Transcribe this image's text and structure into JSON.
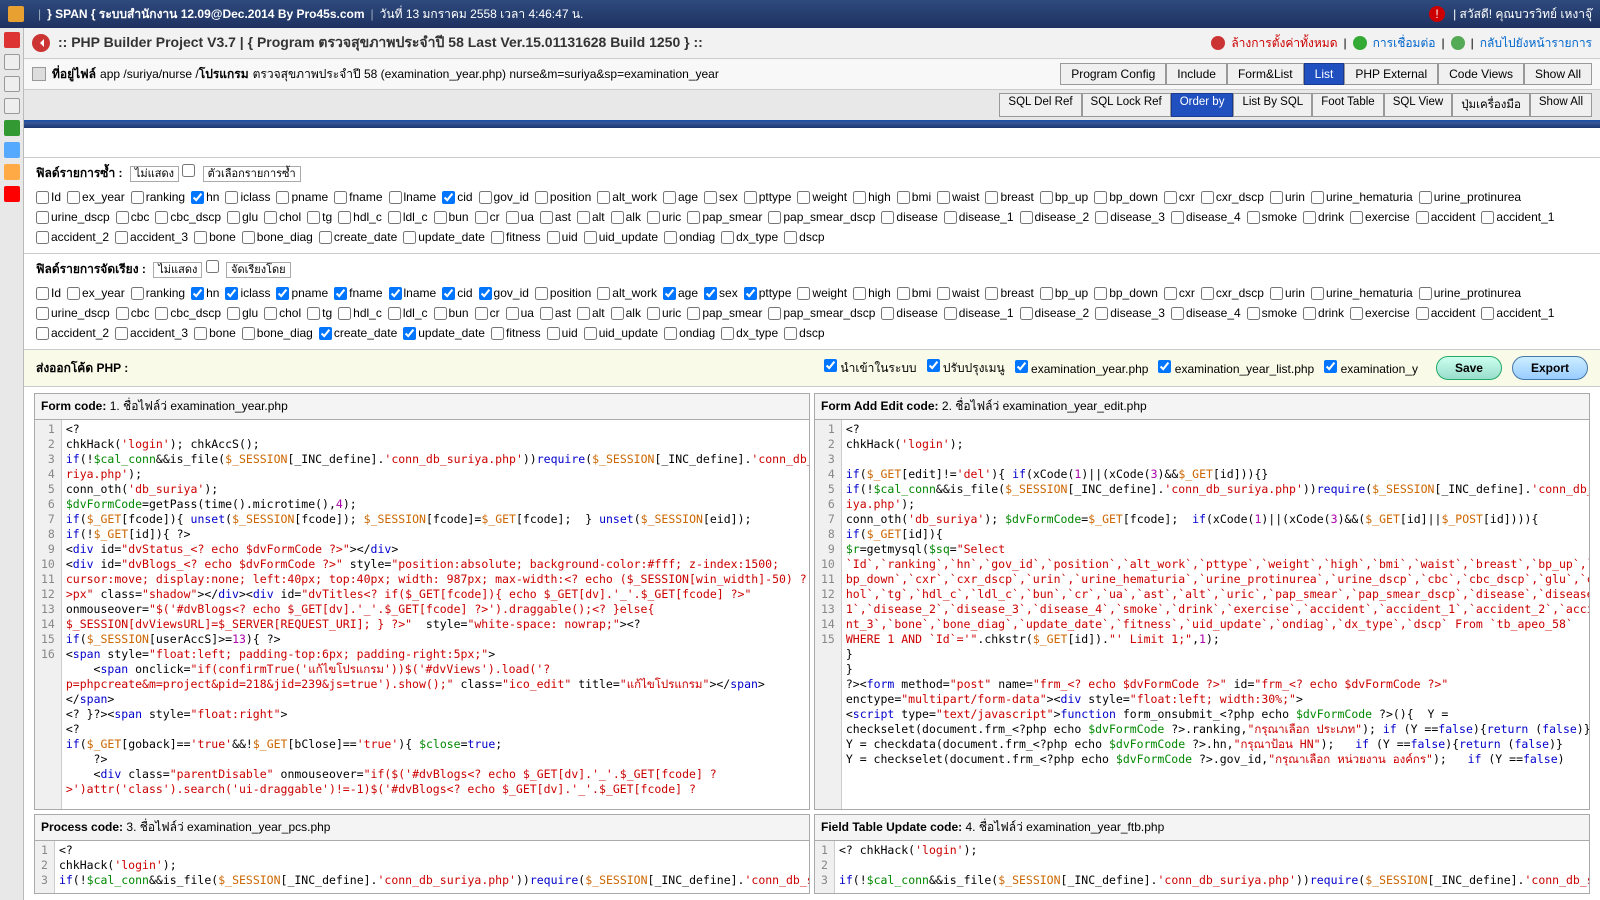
{
  "titlebar": {
    "app": "} SPAN { ระบบสำนักงาน 12.09@Dec.2014 By Pro45s.com",
    "date": "วันที่ 13 มกราคม 2558 เวลา 4:46:47 น.",
    "greeting": "| สวัสดี! คุณบวรวิทย์ เหงาจุ๊"
  },
  "header2": {
    "title": ":: PHP Builder Project V3.7 | { Program ตรวจสุขภาพประจำปี 58 Last Ver.15.01131628 Build 1250 } ::",
    "link_clear": "ล้างการตั้งค่าทั้งหมด",
    "link_conn": "การเชื่อมต่อ",
    "link_back": "กลับไปยังหน้ารายการ"
  },
  "path": {
    "lbl_file": "ที่อยู่ไฟล์",
    "path_app": "app /suriya/nurse /",
    "lbl_prog": "โปรแกรม",
    "prog_text": "ตรวจสุขภาพประจำปี 58 (examination_year.php) nurse&m=suriya&sp=examination_year",
    "tabs": [
      "Program Config",
      "Include",
      "Form&List",
      "List",
      "PHP External",
      "Code Views",
      "Show All"
    ],
    "active_tab": 3
  },
  "subrow": {
    "tabs": [
      "SQL Del Ref",
      "SQL Lock Ref",
      "Order by",
      "List By SQL",
      "Foot Table",
      "SQL View",
      "ปุ่มเครื่องมือ",
      "Show All"
    ],
    "active_tab": 2
  },
  "sec1": {
    "title": "ฟิลด์รายการซ้ำ :",
    "dd1": "ไม่แสดง",
    "dd2": "ตัวเลือกรายการซ้ำ",
    "fields": [
      "Id",
      "ex_year",
      "ranking",
      "hn",
      "iclass",
      "pname",
      "fname",
      "lname",
      "cid",
      "gov_id",
      "position",
      "alt_work",
      "age",
      "sex",
      "pttype",
      "weight",
      "high",
      "bmi",
      "waist",
      "breast",
      "bp_up",
      "bp_down",
      "cxr",
      "cxr_dscp",
      "urin",
      "urine_hematuria",
      "urine_protinurea",
      "urine_dscp",
      "cbc",
      "cbc_dscp",
      "glu",
      "chol",
      "tg",
      "hdl_c",
      "ldl_c",
      "bun",
      "cr",
      "ua",
      "ast",
      "alt",
      "alk",
      "uric",
      "pap_smear",
      "pap_smear_dscp",
      "disease",
      "disease_1",
      "disease_2",
      "disease_3",
      "disease_4",
      "smoke",
      "drink",
      "exercise",
      "accident",
      "accident_1",
      "accident_2",
      "accident_3",
      "bone",
      "bone_diag",
      "create_date",
      "update_date",
      "fitness",
      "uid",
      "uid_update",
      "ondiag",
      "dx_type",
      "dscp"
    ],
    "checked": [
      "hn",
      "cid"
    ]
  },
  "sec2": {
    "title": "ฟิลด์รายการจัดเรียง :",
    "dd1": "ไม่แสดง",
    "dd2": "จัดเรียงโดย",
    "checked": [
      "hn",
      "iclass",
      "pname",
      "fname",
      "lname",
      "cid",
      "gov_id",
      "age",
      "sex",
      "pttype",
      "create_date",
      "update_date"
    ]
  },
  "php": {
    "title": "ส่งออกโค้ด PHP :",
    "opts": [
      "นำเข้าในระบบ",
      "ปรับปรุงเมนู",
      "examination_year.php",
      "examination_year_list.php",
      "examination_y"
    ],
    "save": "Save",
    "export": "Export"
  },
  "panes": {
    "p1": {
      "label": "Form code:",
      "num": "1.",
      "file": "ชื่อไฟล์ว่ examination_year.php"
    },
    "p2": {
      "label": "Form Add Edit code:",
      "num": "2.",
      "file": "ชื่อไฟล์ว่ examination_year_edit.php"
    },
    "p3": {
      "label": "Process code:",
      "num": "3.",
      "file": "ชื่อไฟล์ว่ examination_year_pcs.php"
    },
    "p4": {
      "label": "Field Table Update code:",
      "num": "4.",
      "file": "ชื่อไฟล์ว่ examination_year_ftb.php"
    }
  },
  "code1_lines": 16,
  "code2_lines": 15,
  "code3_lines": 3,
  "code4_lines": 3
}
